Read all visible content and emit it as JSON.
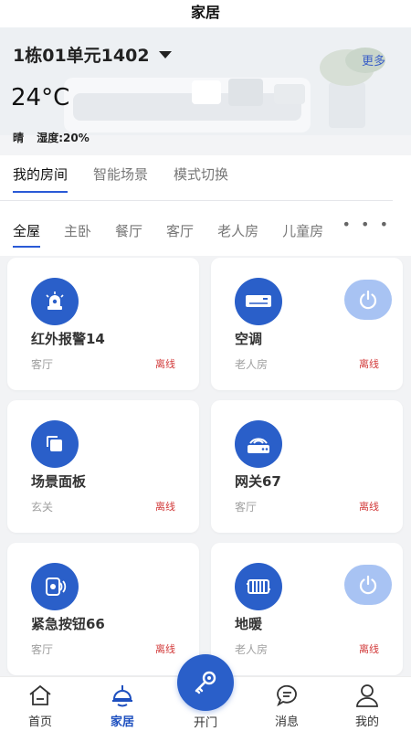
{
  "topbar": {
    "title": "家居"
  },
  "header": {
    "house": "1栋01单元1402",
    "more": "更多",
    "temperature": "24°C",
    "weather": "晴",
    "humidity": "湿度:20%"
  },
  "tabs_primary": [
    {
      "label": "我的房间",
      "active": true
    },
    {
      "label": "智能场景",
      "active": false
    },
    {
      "label": "模式切换",
      "active": false
    }
  ],
  "tabs_rooms": [
    {
      "label": "全屋",
      "active": true
    },
    {
      "label": "主卧",
      "active": false
    },
    {
      "label": "餐厅",
      "active": false
    },
    {
      "label": "客厅",
      "active": false
    },
    {
      "label": "老人房",
      "active": false
    },
    {
      "label": "儿童房",
      "active": false
    }
  ],
  "devices": [
    {
      "name": "红外报警14",
      "room": "客厅",
      "status": "离线",
      "icon": "alarm-icon",
      "power": false
    },
    {
      "name": "空调",
      "room": "老人房",
      "status": "离线",
      "icon": "air-conditioner-icon",
      "power": true
    },
    {
      "name": "场景面板",
      "room": "玄关",
      "status": "离线",
      "icon": "scene-panel-icon",
      "power": false
    },
    {
      "name": "网关67",
      "room": "客厅",
      "status": "离线",
      "icon": "gateway-icon",
      "power": false
    },
    {
      "name": "紧急按钮66",
      "room": "客厅",
      "status": "离线",
      "icon": "emergency-button-icon",
      "power": false
    },
    {
      "name": "地暖",
      "room": "老人房",
      "status": "离线",
      "icon": "floor-heating-icon",
      "power": true
    }
  ],
  "bottom_nav": {
    "home": "首页",
    "smart_home": "家居",
    "open_door": "开门",
    "messages": "消息",
    "mine": "我的"
  },
  "colors": {
    "accent": "#2a5fc9",
    "offline": "#d23b3b",
    "power_bg": "#a8c3f3"
  }
}
